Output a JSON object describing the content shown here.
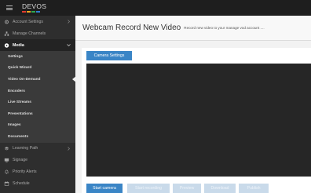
{
  "brand": {
    "logo_text": "DEVOS",
    "logo_colors": [
      "#e23b2e",
      "#f2a623",
      "#2fa84f",
      "#2f7fd1"
    ]
  },
  "sidebar": {
    "items": [
      {
        "label": "Account Settings",
        "icon": "gear-icon",
        "has_chevron": true
      },
      {
        "label": "Manage Channels",
        "icon": "sitemap-icon",
        "has_chevron": false
      },
      {
        "label": "Media",
        "icon": "play-circle-icon",
        "has_chevron": true,
        "active": true
      }
    ],
    "submenu": [
      {
        "label": "Settings"
      },
      {
        "label": "Quick Wizard"
      },
      {
        "label": "Video On-Demand",
        "current": true
      },
      {
        "label": "Encoders"
      },
      {
        "label": "Live Streams"
      },
      {
        "label": "Presentations"
      },
      {
        "label": "Images"
      },
      {
        "label": "Documents"
      }
    ],
    "items_after": [
      {
        "label": "Learning Path",
        "icon": "graduation-icon",
        "has_chevron": true
      },
      {
        "label": "Signage",
        "icon": "tv-icon",
        "has_chevron": false
      },
      {
        "label": "Priority Alerts",
        "icon": "bell-icon",
        "has_chevron": false
      },
      {
        "label": "Schedule",
        "icon": "calendar-icon",
        "has_chevron": false
      }
    ]
  },
  "header": {
    "title": "Webcam Record New Video",
    "subtitle": "Record new video to your manage vod account ...."
  },
  "panel": {
    "camera_settings_label": "Camera Settings",
    "actions": [
      {
        "label": "Start camera",
        "enabled": true
      },
      {
        "label": "Start recording",
        "enabled": false
      },
      {
        "label": "Preview",
        "enabled": false
      },
      {
        "label": "Download",
        "enabled": false
      },
      {
        "label": "Publish",
        "enabled": false
      }
    ]
  },
  "colors": {
    "accent": "#3a85c6",
    "sidebar_bg": "#2e2e2e",
    "topbar_bg": "#1e1e1e",
    "video_bg": "#262626"
  }
}
